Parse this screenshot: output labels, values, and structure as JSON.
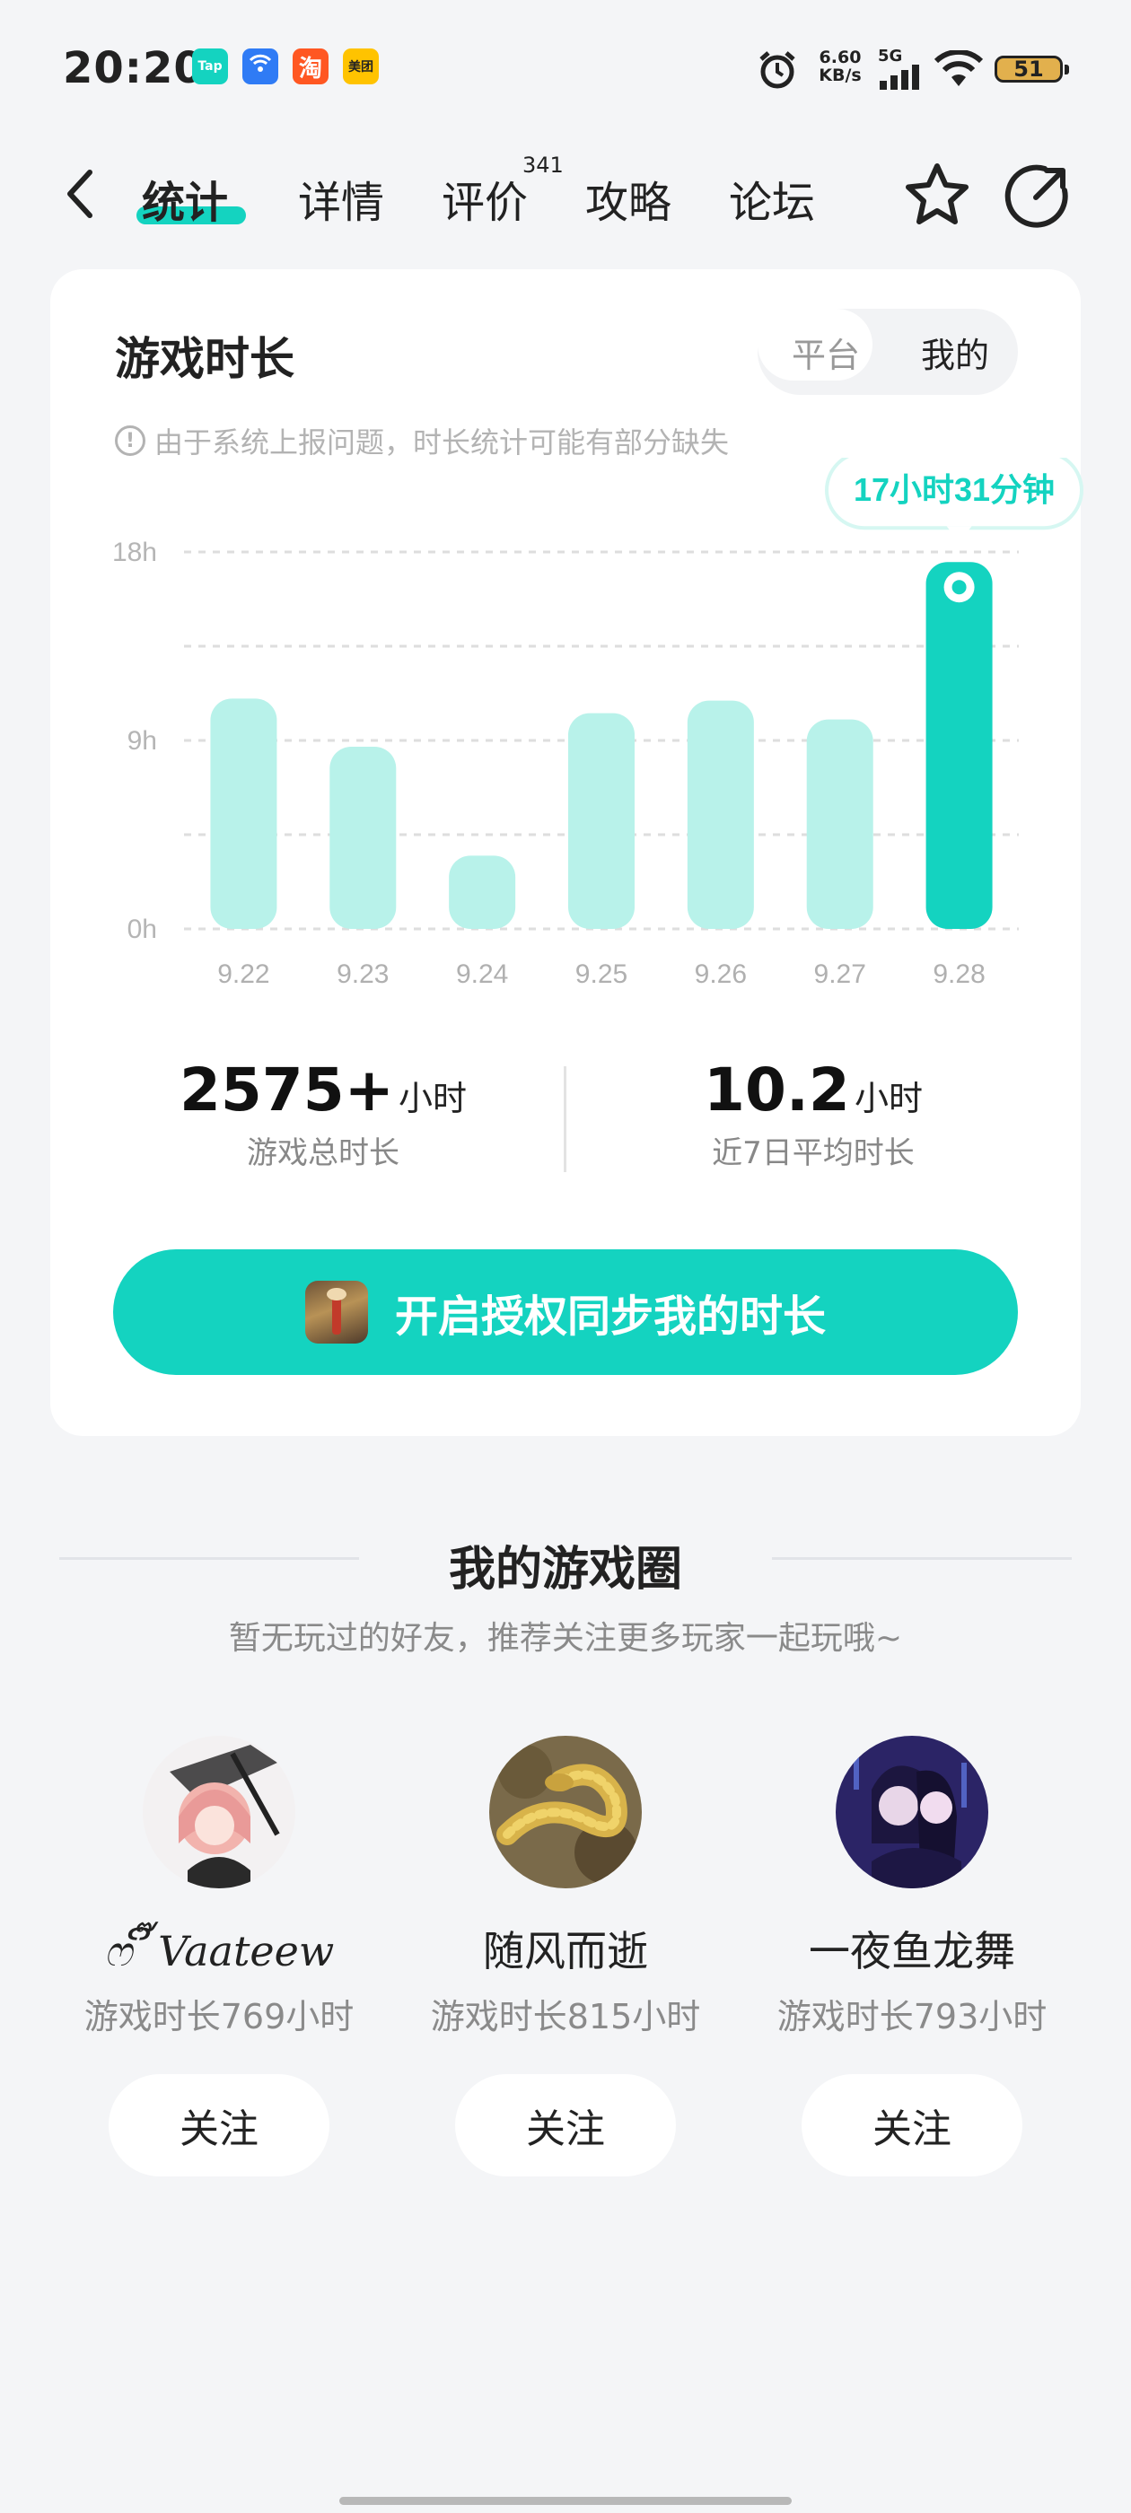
{
  "status_bar": {
    "time": "20:20",
    "apps": [
      {
        "name": "taptap",
        "text": "Tap",
        "color": "#14d3c0"
      },
      {
        "name": "network",
        "text": "((·))",
        "color": "#2f7bf5"
      },
      {
        "name": "taobao",
        "text": "淘",
        "color": "#ff5722"
      },
      {
        "name": "meituan",
        "text": "美团",
        "color": "#ffc300"
      }
    ],
    "speed_value": "6.60",
    "speed_unit": "KB/s",
    "network_type": "5G",
    "battery": "51"
  },
  "nav": {
    "tabs": [
      {
        "label": "统计",
        "active": true
      },
      {
        "label": "详情"
      },
      {
        "label": "评价"
      },
      {
        "label": "攻略"
      },
      {
        "label": "论坛"
      }
    ],
    "review_count": "341"
  },
  "playtime": {
    "title": "游戏时长",
    "toggle": {
      "platform": "平台",
      "mine": "我的",
      "selected": "我的"
    },
    "notice": "由于系统上报问题，时长统计可能有部分缺失",
    "tooltip": "17小时31分钟",
    "total_value": "2575+",
    "total_unit": "小时",
    "total_label": "游戏总时长",
    "avg_value": "10.2",
    "avg_unit": "小时",
    "avg_label": "近7日平均时长",
    "cta_label": "开启授权同步我的时长"
  },
  "chart_data": {
    "type": "bar",
    "categories": [
      "9.22",
      "9.23",
      "9.24",
      "9.25",
      "9.26",
      "9.27",
      "9.28"
    ],
    "values": [
      11.0,
      8.7,
      3.5,
      10.3,
      10.9,
      10.0,
      17.52
    ],
    "yticks": [
      "18h",
      "9h",
      "0h"
    ],
    "ylim": [
      0,
      18
    ],
    "highlight_index": 6,
    "colors": {
      "bar": "#b8f2ea",
      "highlight": "#14d3c0"
    },
    "grid": true
  },
  "game_circle": {
    "title": "我的游戏圈",
    "subtitle": "暂无玩过的好友，推荐关注更多玩家一起玩哦~",
    "users": [
      {
        "name": "ෆ ິ๊ Vaateew",
        "hours": "游戏时长769小时",
        "follow": "关注"
      },
      {
        "name": "随风而逝",
        "hours": "游戏时长815小时",
        "follow": "关注"
      },
      {
        "name": "一夜鱼龙舞",
        "hours": "游戏时长793小时",
        "follow": "关注"
      }
    ]
  }
}
